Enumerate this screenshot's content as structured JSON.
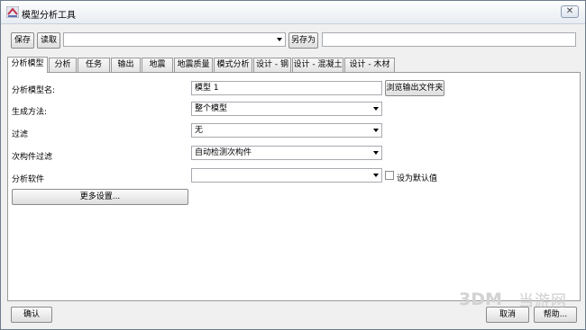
{
  "window": {
    "title": "模型分析工具",
    "close_label": "✕"
  },
  "toolbar": {
    "save_label": "保存",
    "load_label": "读取",
    "preset_value": "",
    "save_as_label": "另存为",
    "save_as_value": ""
  },
  "tabs": [
    {
      "label": "分析模型",
      "active": true
    },
    {
      "label": "分析",
      "active": false
    },
    {
      "label": "任务",
      "active": false
    },
    {
      "label": "输出",
      "active": false
    },
    {
      "label": "地震",
      "active": false
    },
    {
      "label": "地震质量",
      "active": false
    },
    {
      "label": "模式分析",
      "active": false
    },
    {
      "label": "设计 - 钢",
      "active": false
    },
    {
      "label": "设计 - 混凝土",
      "active": false
    },
    {
      "label": "设计 - 木材",
      "active": false
    }
  ],
  "form": {
    "model_name_label": "分析模型名:",
    "model_name_value": "模型 1",
    "browse_folder_label": "浏览输出文件夹",
    "creation_method_label": "生成方法:",
    "creation_method_value": "整个模型",
    "filter_label": "过滤",
    "filter_value": "无",
    "secondary_filter_label": "次构件过滤",
    "secondary_filter_value": "自动检测次构件",
    "software_label": "分析软件",
    "software_value": "",
    "set_default_label": "设为默认值",
    "more_settings_label": "更多设置..."
  },
  "footer": {
    "ok_label": "确认",
    "cancel_label": "取消",
    "help_label": "帮助..."
  },
  "watermark": {
    "text": "当游网"
  },
  "colors": {
    "window_bg": "#f0f0f0",
    "panel_bg": "#ffffff",
    "border": "#9a9a9a"
  }
}
